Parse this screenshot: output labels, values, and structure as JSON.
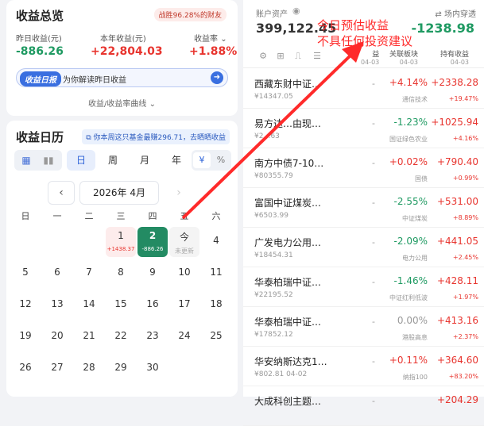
{
  "summary": {
    "title": "收益总览",
    "badge": "战胜96.28%的财友",
    "yesterday_label": "昨日收益(元)",
    "yesterday_value": "-886.26",
    "year_label": "本年收益(元)",
    "year_value": "+22,804.03",
    "rate_label": "收益率",
    "rate_value": "+1.88%",
    "interpret_tag": "收益日报",
    "interpret_text": "为你解读昨日收益",
    "curve_link": "收益/收益率曲线"
  },
  "calendar": {
    "title": "收益日历",
    "promo": "你本周这只基金最赚296.71，去晒晒收益",
    "periods": [
      "日",
      "周",
      "月",
      "年"
    ],
    "active_period": "日",
    "units": [
      "¥",
      "%"
    ],
    "month": "2026年 4月",
    "weekdays": [
      "日",
      "一",
      "二",
      "三",
      "四",
      "五",
      "六"
    ],
    "days": [
      {
        "d": "1",
        "sub": "+1438.37",
        "kind": "profit"
      },
      {
        "d": "2",
        "sub": "-886.26",
        "kind": "loss"
      },
      {
        "d": "今",
        "sub": "未更新",
        "kind": "today"
      },
      {
        "d": "4"
      },
      {
        "d": "5"
      },
      {
        "d": "6"
      },
      {
        "d": "7"
      },
      {
        "d": "8"
      },
      {
        "d": "9"
      },
      {
        "d": "10"
      },
      {
        "d": "11"
      },
      {
        "d": "12"
      },
      {
        "d": "13"
      },
      {
        "d": "14"
      },
      {
        "d": "15"
      },
      {
        "d": "16"
      },
      {
        "d": "17"
      },
      {
        "d": "18"
      },
      {
        "d": "19"
      },
      {
        "d": "20"
      },
      {
        "d": "21"
      },
      {
        "d": "22"
      },
      {
        "d": "23"
      },
      {
        "d": "24"
      },
      {
        "d": "25"
      },
      {
        "d": "26"
      },
      {
        "d": "27"
      },
      {
        "d": "28"
      },
      {
        "d": "29"
      },
      {
        "d": "30"
      }
    ]
  },
  "account": {
    "label": "账户资产",
    "value": "399,122.45",
    "toggle": "场内穿透",
    "estimate": "-1238.98"
  },
  "columns": {
    "c1_title": "益",
    "c1_date": "04-03",
    "c2_title": "关联板块",
    "c2_date": "04-03",
    "c3_title": "持有收益",
    "c3_date": "04-03"
  },
  "funds": [
    {
      "name": "西藏东财中证…",
      "amt": "¥14347.05",
      "chg": "+4.14%",
      "chg_dir": "up",
      "sector": "通信技术",
      "hold": "+2338.28",
      "hold_dir": "up",
      "holdpct": "+19.47%"
    },
    {
      "name": "易方达…由现…",
      "amt": "¥2…63",
      "chg": "-1.23%",
      "chg_dir": "down",
      "sector": "国证绿色农业",
      "hold": "+1025.94",
      "hold_dir": "up",
      "holdpct": "+4.16%"
    },
    {
      "name": "南方中债7-10…",
      "amt": "¥80355.79",
      "chg": "+0.02%",
      "chg_dir": "up",
      "sector": "国债",
      "hold": "+790.40",
      "hold_dir": "up",
      "holdpct": "+0.99%"
    },
    {
      "name": "富国中证煤炭…",
      "amt": "¥6503.99",
      "chg": "-2.55%",
      "chg_dir": "down",
      "sector": "中证煤炭",
      "hold": "+531.00",
      "hold_dir": "up",
      "holdpct": "+8.89%"
    },
    {
      "name": "广发电力公用…",
      "amt": "¥18454.31",
      "chg": "-2.09%",
      "chg_dir": "down",
      "sector": "电力公用",
      "hold": "+441.05",
      "hold_dir": "up",
      "holdpct": "+2.45%"
    },
    {
      "name": "华泰柏瑞中证…",
      "amt": "¥22195.52",
      "chg": "-1.46%",
      "chg_dir": "down",
      "sector": "中证红利低波",
      "hold": "+428.11",
      "hold_dir": "up",
      "holdpct": "+1.97%"
    },
    {
      "name": "华泰柏瑞中证…",
      "amt": "¥17852.12",
      "chg": "0.00%",
      "chg_dir": "flat",
      "sector": "港股高息",
      "hold": "+413.16",
      "hold_dir": "up",
      "holdpct": "+2.37%"
    },
    {
      "name": "华安纳斯达克1…",
      "amt": "¥802.81  04-02",
      "chg": "+0.11%",
      "chg_dir": "up",
      "sector": "纳指100",
      "hold": "+364.60",
      "hold_dir": "up",
      "holdpct": "+83.20%"
    },
    {
      "name": "大成科创主题…",
      "amt": "",
      "chg": "",
      "chg_dir": "up",
      "sector": "",
      "hold": "+204.29",
      "hold_dir": "up",
      "holdpct": ""
    }
  ],
  "annotation": {
    "line1": "今日预估收益",
    "line2": "不具任何投资建议"
  },
  "icons": [
    "eye-icon",
    "swap-icon",
    "settings-icon",
    "grid-icon",
    "chart-icon",
    "list-icon",
    "chevron-left-icon",
    "chevron-right-icon",
    "arrow-right-icon",
    "calendar-icon",
    "bar-chart-icon"
  ],
  "colors": {
    "profit": "#e8352f",
    "loss": "#1f9a62",
    "accent": "#3a6fe0",
    "annotation": "#ff2a2a"
  }
}
